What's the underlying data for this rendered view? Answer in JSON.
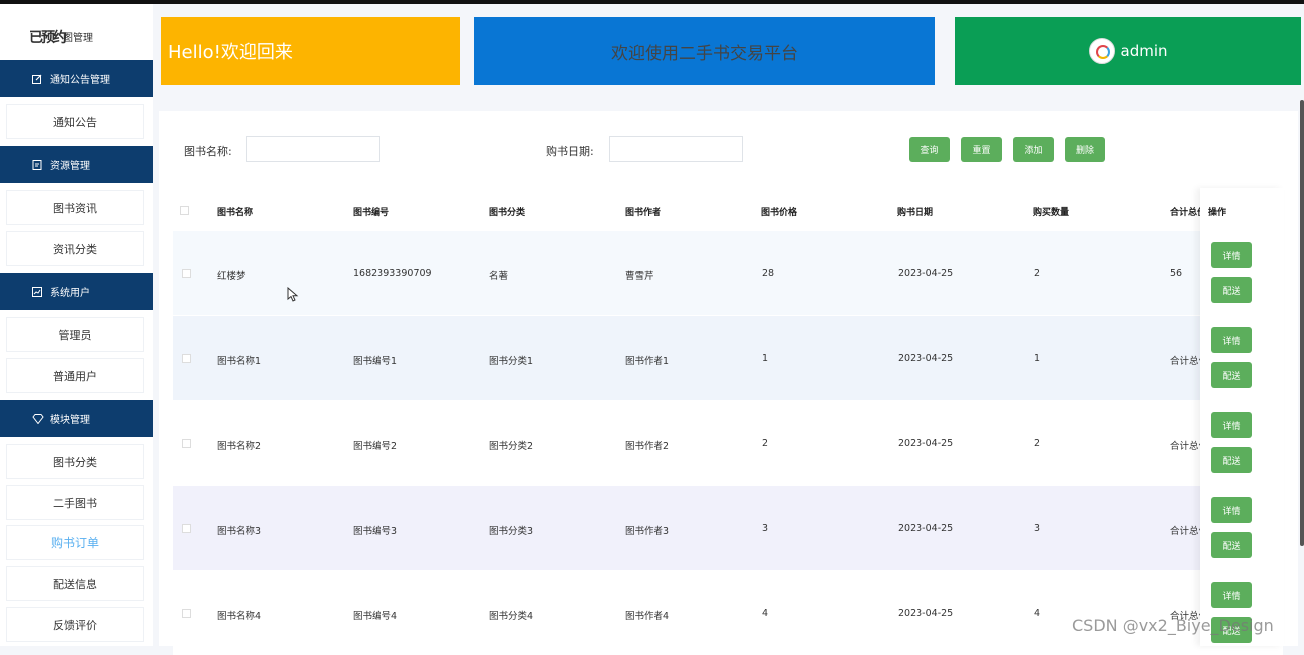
{
  "sidebar": {
    "top_item": {
      "big": "已预约",
      "small": "图管理"
    },
    "groups": [
      {
        "title": "通知公告管理",
        "icon": "edit-icon",
        "items": [
          "通知公告"
        ]
      },
      {
        "title": "资源管理",
        "icon": "document-icon",
        "items": [
          "图书资讯",
          "资讯分类"
        ]
      },
      {
        "title": "系统用户",
        "icon": "chart-icon",
        "items": [
          "管理员",
          "普通用户"
        ]
      },
      {
        "title": "模块管理",
        "icon": "diamond-icon",
        "items": [
          "图书分类",
          "二手图书",
          "购书订单",
          "配送信息",
          "反馈评价"
        ]
      }
    ],
    "active_item": "购书订单"
  },
  "banners": {
    "welcome": "Hello!欢迎回来",
    "platform": "欢迎使用二手书交易平台",
    "user": "admin"
  },
  "search": {
    "name_label": "图书名称:",
    "date_label": "购书日期:",
    "buttons": {
      "query": "查询",
      "reset": "重置",
      "add": "添加",
      "delete": "删除"
    }
  },
  "table": {
    "headers": [
      "图书名称",
      "图书编号",
      "图书分类",
      "图书作者",
      "图书价格",
      "购书日期",
      "购买数量",
      "合计总价",
      "操作"
    ],
    "rows": [
      [
        "红楼梦",
        "1682393390709",
        "名著",
        "曹雪芹",
        "28",
        "2023-04-25",
        "2",
        "56"
      ],
      [
        "图书名称1",
        "图书编号1",
        "图书分类1",
        "图书作者1",
        "1",
        "2023-04-25",
        "1",
        "合计总价1"
      ],
      [
        "图书名称2",
        "图书编号2",
        "图书分类2",
        "图书作者2",
        "2",
        "2023-04-25",
        "2",
        "合计总价2"
      ],
      [
        "图书名称3",
        "图书编号3",
        "图书分类3",
        "图书作者3",
        "3",
        "2023-04-25",
        "3",
        "合计总价3"
      ],
      [
        "图书名称4",
        "图书编号4",
        "图书分类4",
        "图书作者4",
        "4",
        "2023-04-25",
        "4",
        "合计总价4"
      ]
    ],
    "row_actions": {
      "detail": "详情",
      "delivery": "配送"
    }
  },
  "watermark": "CSDN @vx2_Biye_Design",
  "colors": {
    "sidebar_head": "#0d3d6e",
    "banner_yellow": "#fdb400",
    "banner_blue": "#0976d4",
    "banner_green": "#0a9e55",
    "button_green": "#5cae5c",
    "active_link": "#5ab0f0"
  }
}
